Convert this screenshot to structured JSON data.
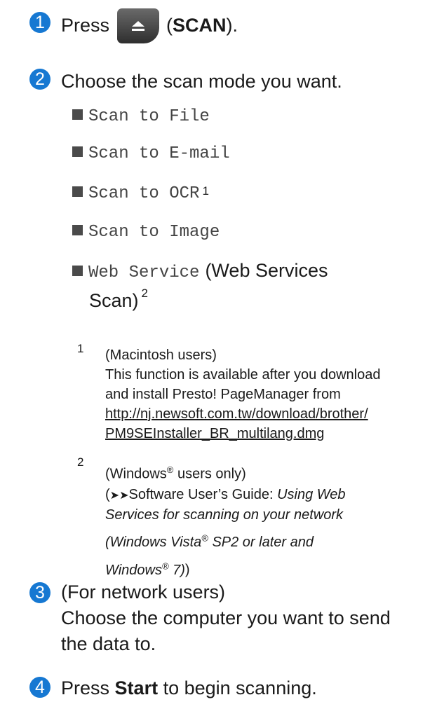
{
  "steps": [
    {
      "num": "1",
      "pre": "Press",
      "bold": "SCAN",
      "open": "(",
      "close": ")."
    },
    {
      "num": "2",
      "text": "Choose the scan mode you want."
    },
    {
      "num": "3",
      "line1": "(For network users)",
      "line2": "Choose the computer you want to send",
      "line3": "the data to."
    },
    {
      "num": "4",
      "pre": "Press",
      "bold": "Start",
      "post": "to begin scanning."
    }
  ],
  "options": [
    {
      "label": "Scan to File"
    },
    {
      "label": "Scan to E-mail"
    },
    {
      "label": "Scan to OCR",
      "sup": "1"
    },
    {
      "label": "Scan to Image"
    },
    {
      "label": "Web Service",
      "extra1": "(Web Services",
      "extra2": "Scan)",
      "sup": "2"
    }
  ],
  "footnotes": {
    "f1": {
      "num": "1",
      "l1": "(Macintosh users)",
      "l2": "This function is available after you download",
      "l3": "and install Presto! PageManager from",
      "link1": "http://nj.newsoft.com.tw/download/brother/",
      "link2": "PM9SEInstaller_BR_multilang.dmg"
    },
    "f2": {
      "num": "2",
      "l1a": "(Windows",
      "reg": "®",
      "l1b": "users only)",
      "l2pre": "(",
      "arrows": "➤➤",
      "l2a": "Software User’s Guide:",
      "l2b": "Using Web",
      "l3": "Services for scanning on your network",
      "l4a": "(Windows Vista",
      "l4b": "SP2 or later and",
      "l5a": "Windows",
      "l5b": "7)",
      "l5c": ")"
    }
  },
  "colors": {
    "accent": "#1678d2"
  }
}
